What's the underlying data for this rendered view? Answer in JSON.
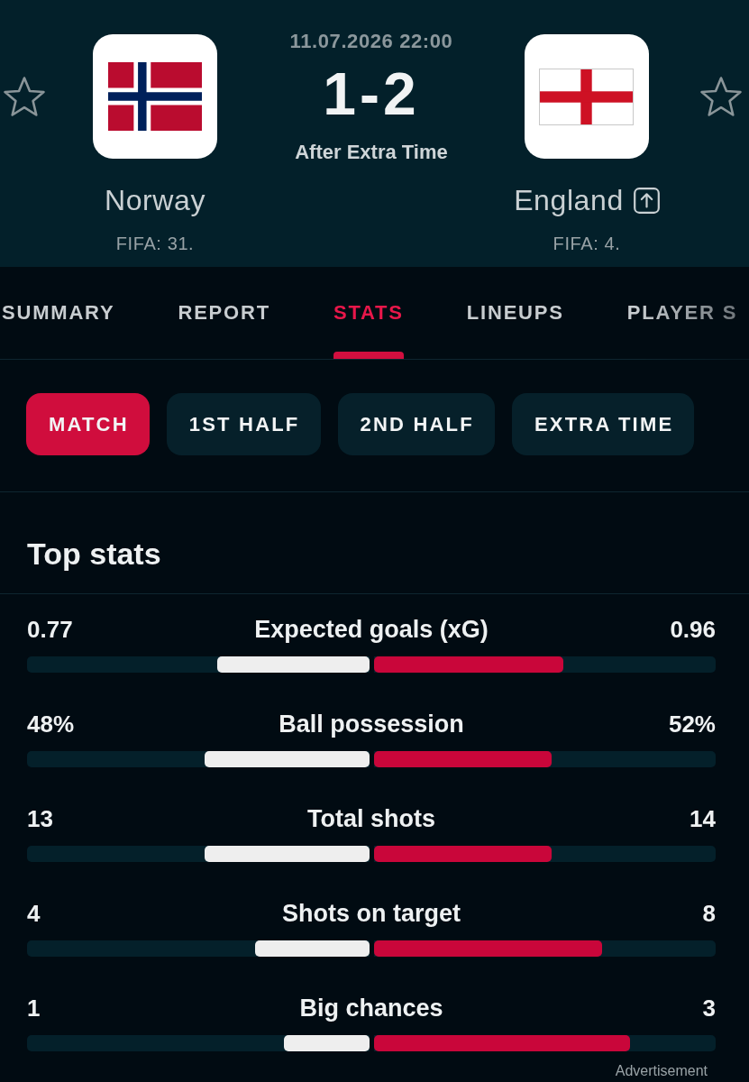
{
  "match": {
    "datetime": "11.07.2026 22:00",
    "score": "1-2",
    "status": "After Extra Time"
  },
  "teams": [
    {
      "name": "Norway",
      "ranking": "FIFA: 31.",
      "favorite": false,
      "link_badge": false
    },
    {
      "name": "England",
      "ranking": "FIFA: 4.",
      "favorite": false,
      "link_badge": true
    }
  ],
  "tabs": [
    {
      "label": "SUMMARY",
      "selected": false
    },
    {
      "label": "REPORT",
      "selected": false
    },
    {
      "label": "STATS",
      "selected": true
    },
    {
      "label": "LINEUPS",
      "selected": false
    },
    {
      "label": "PLAYER S",
      "selected": false
    }
  ],
  "periods": [
    {
      "label": "MATCH",
      "selected": true
    },
    {
      "label": "1ST HALF",
      "selected": false
    },
    {
      "label": "2ND HALF",
      "selected": false
    },
    {
      "label": "EXTRA TIME",
      "selected": false
    }
  ],
  "top_stats": {
    "title": "Top stats",
    "rows": [
      {
        "name": "Expected goals (xG)",
        "home": {
          "value": "0.77",
          "level": 0.445
        },
        "away": {
          "value": "0.96",
          "level": 0.555
        }
      },
      {
        "name": "Ball possession",
        "home": {
          "value": "48%",
          "level": 0.48
        },
        "away": {
          "value": "52%",
          "level": 0.52
        }
      },
      {
        "name": "Total shots",
        "home": {
          "value": "13",
          "level": 0.48
        },
        "away": {
          "value": "14",
          "level": 0.52
        }
      },
      {
        "name": "Shots on target",
        "home": {
          "value": "4",
          "level": 0.333
        },
        "away": {
          "value": "8",
          "level": 0.667
        }
      },
      {
        "name": "Big chances",
        "home": {
          "value": "1",
          "level": 0.25
        },
        "away": {
          "value": "3",
          "level": 0.75
        }
      }
    ]
  },
  "advertisement": "Advertisement"
}
